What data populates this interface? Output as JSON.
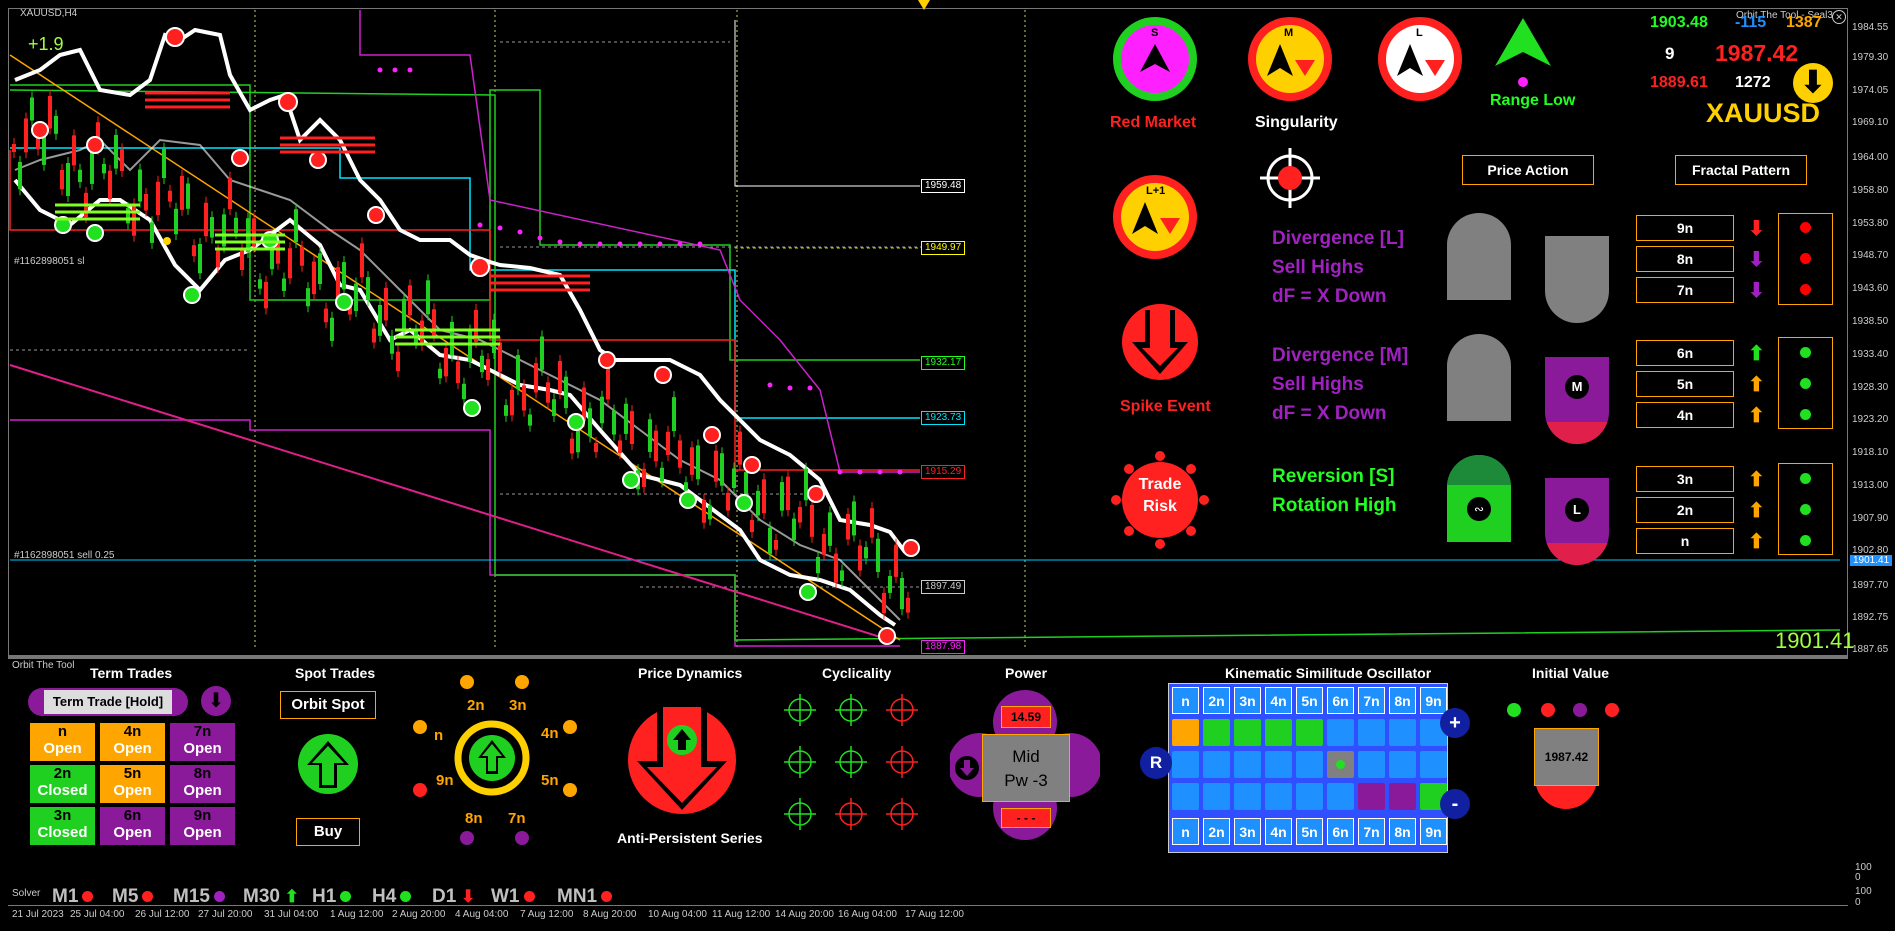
{
  "chart": {
    "symbol": "XAUUSD,H4",
    "pnl": "+1.9",
    "order_label_1": "#1162898051 sl",
    "order_label_2": "#1162898051 sell 0.25",
    "big_price": "1901.41",
    "price_levels": [
      "1959.48",
      "1949.97",
      "1932.17",
      "1923.73",
      "1915.29",
      "1897.49",
      "1887.98"
    ],
    "current_price_tag": "1901.41",
    "y_axis": [
      "1984.55",
      "1979.30",
      "1974.05",
      "1969.10",
      "1964.00",
      "1958.80",
      "1953.80",
      "1948.70",
      "1943.60",
      "1938.50",
      "1933.40",
      "1928.30",
      "1923.20",
      "1918.10",
      "1913.00",
      "1907.90",
      "1902.80",
      "1897.70",
      "1892.75",
      "1887.65"
    ],
    "y_axis_lower": [
      "100",
      "0",
      "100",
      "0"
    ],
    "time_axis": [
      "21 Jul 2023",
      "25 Jul 04:00",
      "26 Jul 12:00",
      "27 Jul 20:00",
      "31 Jul 04:00",
      "1 Aug 12:00",
      "2 Aug 20:00",
      "4 Aug 04:00",
      "7 Aug 12:00",
      "8 Aug 20:00",
      "10 Aug 04:00",
      "11 Aug 12:00",
      "14 Aug 20:00",
      "16 Aug 04:00",
      "17 Aug 12:00"
    ]
  },
  "header_right": {
    "tool_name": "Orbit The Tool - Seal3",
    "v1": "1903.48",
    "v2": "-115",
    "v3": "1387",
    "v4": "9",
    "v5": "1987.42",
    "v6": "1889.61",
    "v7": "1272",
    "symbol": "XAUUSD"
  },
  "indicators": {
    "s_label": "S",
    "m_label": "M",
    "l_label": "L",
    "l1_label": "L+1",
    "red_market": "Red Market",
    "singularity": "Singularity",
    "range_low": "Range Low",
    "spike_event": "Spike Event",
    "trade_risk_1": "Trade",
    "trade_risk_2": "Risk",
    "price_action": "Price Action",
    "fractal_pattern": "Fractal Pattern",
    "div_l": [
      "Divergence [L]",
      "Sell Highs",
      "dF = X Down"
    ],
    "div_m": [
      "Divergence [M]",
      "Sell Highs",
      "dF = X Down"
    ],
    "reversion": [
      "Reversion [S]",
      "Rotation High"
    ],
    "fractal_rows": [
      {
        "label": "9n",
        "arrow": "down",
        "arrow_color": "#ff2020",
        "dot": "#ff0000"
      },
      {
        "label": "8n",
        "arrow": "down",
        "arrow_color": "#a020c0",
        "dot": "#ff0000"
      },
      {
        "label": "7n",
        "arrow": "down",
        "arrow_color": "#a020c0",
        "dot": "#ff0000"
      },
      {
        "label": "6n",
        "arrow": "up",
        "arrow_color": "#20e020",
        "dot": "#20e020"
      },
      {
        "label": "5n",
        "arrow": "up",
        "arrow_color": "#ffa500",
        "dot": "#20e020"
      },
      {
        "label": "4n",
        "arrow": "up",
        "arrow_color": "#ffa500",
        "dot": "#20e020"
      },
      {
        "label": "3n",
        "arrow": "up",
        "arrow_color": "#ffa500",
        "dot": "#20e020"
      },
      {
        "label": "2n",
        "arrow": "up",
        "arrow_color": "#ffa500",
        "dot": "#20e020"
      },
      {
        "label": "n",
        "arrow": "up",
        "arrow_color": "#ffa500",
        "dot": "#20e020"
      }
    ],
    "m_badge": "M",
    "l_badge": "L"
  },
  "bottom": {
    "tool_name": "Orbit The Tool",
    "term_trades": "Term Trades",
    "term_trade_hold": "Term Trade [Hold]",
    "term_cells": [
      {
        "l1": "n",
        "l2": "Open",
        "bg": "#ffa500"
      },
      {
        "l1": "4n",
        "l2": "Open",
        "bg": "#ffa500"
      },
      {
        "l1": "7n",
        "l2": "Open",
        "bg": "#8b1a9b"
      },
      {
        "l1": "2n",
        "l2": "Closed",
        "bg": "#20d020"
      },
      {
        "l1": "5n",
        "l2": "Open",
        "bg": "#ffa500"
      },
      {
        "l1": "8n",
        "l2": "Open",
        "bg": "#8b1a9b"
      },
      {
        "l1": "3n",
        "l2": "Closed",
        "bg": "#20d020"
      },
      {
        "l1": "6n",
        "l2": "Open",
        "bg": "#8b1a9b"
      },
      {
        "l1": "9n",
        "l2": "Open",
        "bg": "#8b1a9b"
      }
    ],
    "spot_trades": "Spot Trades",
    "orbit_spot": "Orbit Spot",
    "buy": "Buy",
    "orbit_labels": [
      "2n",
      "3n",
      "n",
      "4n",
      "9n",
      "5n",
      "8n",
      "7n"
    ],
    "price_dynamics": "Price Dynamics",
    "anti_persistent": "Anti-Persistent Series",
    "cyclicality": "Cyclicality",
    "power": "Power",
    "power_value": "14.59",
    "power_mid": "Mid",
    "power_pw": "Pw -3",
    "power_dash": "- - -",
    "kso_title": "Kinematic Similitude Oscillator",
    "kso_header": [
      "n",
      "2n",
      "3n",
      "4n",
      "5n",
      "6n",
      "7n",
      "8n",
      "9n"
    ],
    "kso_rows": [
      [
        "#ffa500",
        "#20d020",
        "#20d020",
        "#20d020",
        "#20d020",
        "#1e90ff",
        "#1e90ff",
        "#1e90ff",
        "#1e90ff"
      ],
      [
        "#1e90ff",
        "#1e90ff",
        "#1e90ff",
        "#1e90ff",
        "#1e90ff",
        "#808080",
        "#1e90ff",
        "#1e90ff",
        "#1e90ff"
      ],
      [
        "#1e90ff",
        "#1e90ff",
        "#1e90ff",
        "#1e90ff",
        "#1e90ff",
        "#1e90ff",
        "#8b1a9b",
        "#8b1a9b",
        "#20d020"
      ]
    ],
    "kso_r": "R",
    "kso_plus": "+",
    "kso_minus": "-",
    "initial_value": "Initial Value",
    "initial_value_num": "1987.42",
    "solver": "Solver",
    "timeframes": [
      {
        "label": "M1",
        "mark": "dot",
        "color": "#ff2020"
      },
      {
        "label": "M5",
        "mark": "dot",
        "color": "#ff2020"
      },
      {
        "label": "M15",
        "mark": "dot",
        "color": "#a020c0"
      },
      {
        "label": "M30",
        "mark": "up",
        "color": "#20e020"
      },
      {
        "label": "H1",
        "mark": "dot",
        "color": "#20e020"
      },
      {
        "label": "H4",
        "mark": "dot",
        "color": "#20e020"
      },
      {
        "label": "D1",
        "mark": "down",
        "color": "#ff2020"
      },
      {
        "label": "W1",
        "mark": "dot",
        "color": "#ff2020"
      },
      {
        "label": "MN1",
        "mark": "dot",
        "color": "#ff2020"
      }
    ]
  }
}
